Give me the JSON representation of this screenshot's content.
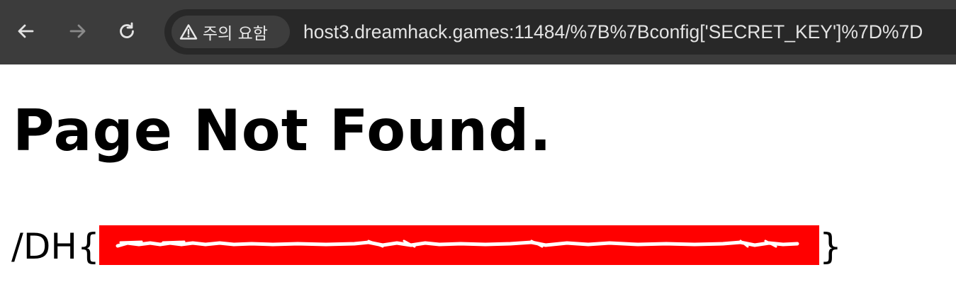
{
  "browser": {
    "security_label": "주의 요함",
    "url": "host3.dreamhack.games:11484/%7B%7Bconfig['SECRET_KEY']%7D%7D",
    "icons": {
      "back": "arrow-left-icon",
      "forward": "arrow-right-icon",
      "reload": "reload-icon",
      "security": "warning-triangle-icon"
    }
  },
  "page": {
    "title": "Page Not Found.",
    "flag_prefix": "/DH{",
    "flag_suffix": "}",
    "redaction_color": "#ff0000"
  }
}
